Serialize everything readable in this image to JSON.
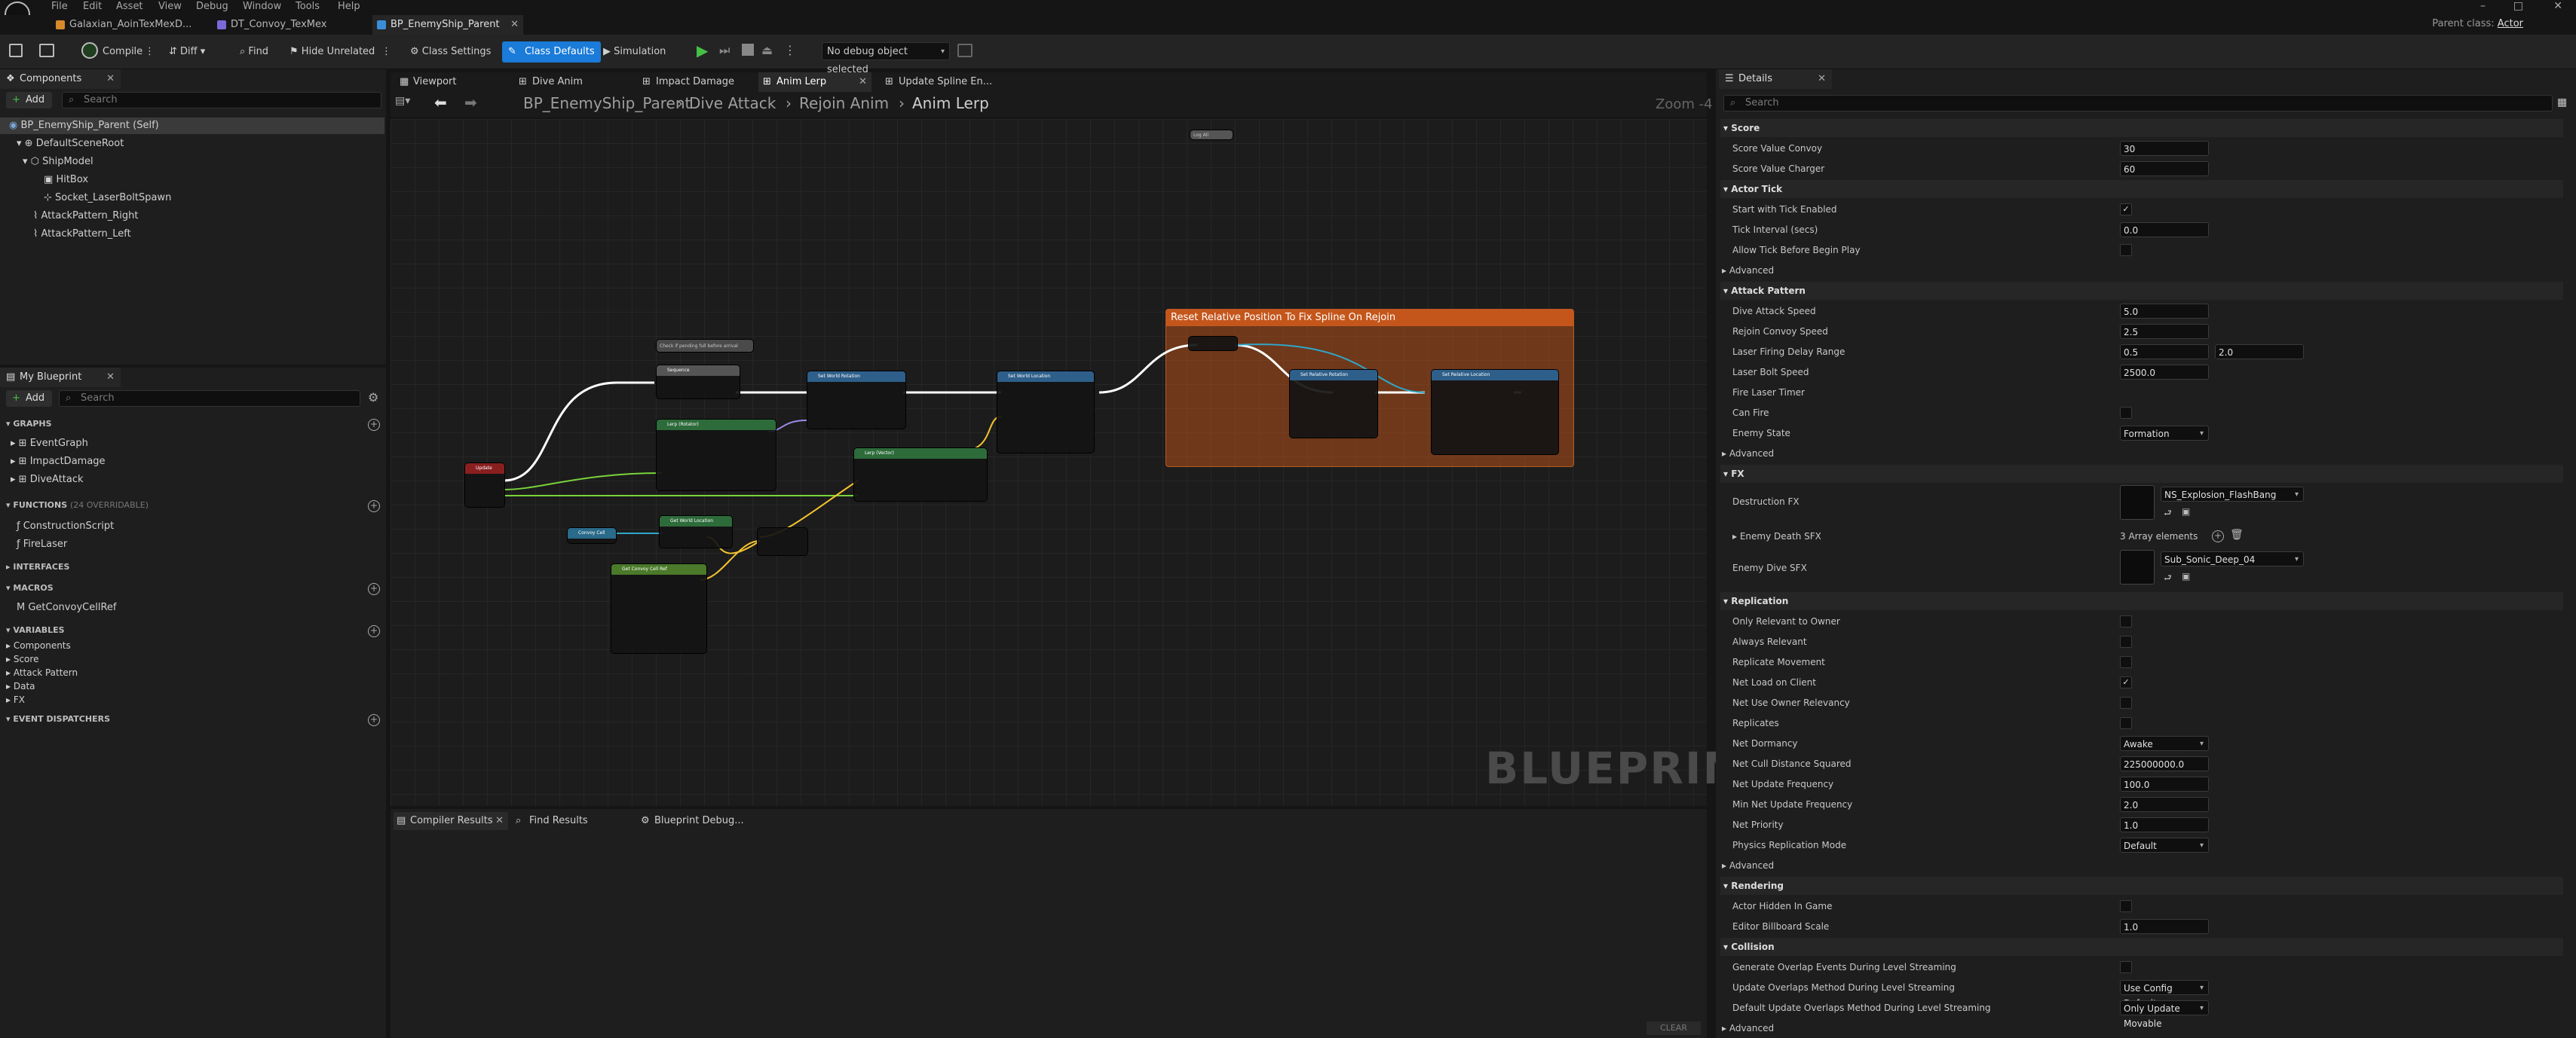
{
  "menu": [
    "File",
    "Edit",
    "Asset",
    "View",
    "Debug",
    "Window",
    "Tools",
    "Help"
  ],
  "right_label": "Parent class:",
  "right_value": "Actor",
  "tabs": [
    {
      "label": "Galaxian_AoinTexMexD..."
    },
    {
      "label": "DT_Convoy_TexMex"
    },
    {
      "label": "BP_EnemyShip_Parent"
    }
  ],
  "toolbar": {
    "compile": "Compile",
    "diff": "Diff",
    "find": "Find",
    "hide_unrelated": "Hide Unrelated",
    "class_settings": "Class Settings",
    "class_defaults": "Class Defaults",
    "simulation": "Simulation",
    "debug_object": "No debug object selected"
  },
  "components": {
    "title": "Components",
    "add": "Add",
    "search_placeholder": "Search",
    "items": [
      "BP_EnemyShip_Parent (Self)",
      "DefaultSceneRoot",
      "ShipModel",
      "HitBox",
      "Socket_LaserBoltSpawn",
      "AttackPattern_Right",
      "AttackPattern_Left"
    ]
  },
  "my_blueprint": {
    "title": "My Blueprint",
    "add": "Add",
    "search_placeholder": "Search",
    "graphs_header": "GRAPHS",
    "graphs": [
      "EventGraph",
      "ImpactDamage",
      "DiveAttack"
    ],
    "functions_header": "FUNCTIONS",
    "functions_count": "(24 OVERRIDABLE)",
    "functions": [
      "ConstructionScript",
      "FireLaser"
    ],
    "interfaces_header": "INTERFACES",
    "macros_header": "MACROS",
    "macros": [
      "GetConvoyCellRef"
    ],
    "variables_header": "VARIABLES",
    "variables": [
      "Components",
      "Score",
      "Attack Pattern",
      "Data",
      "FX"
    ],
    "dispatchers_header": "EVENT DISPATCHERS"
  },
  "graph_tabs": [
    "Viewport",
    "Dive Anim",
    "Impact Damage",
    "Anim Lerp",
    "Update Spline En..."
  ],
  "breadcrumb": [
    "BP_EnemyShip_Parent",
    "Dive Attack",
    "Rejoin Anim",
    "Anim Lerp"
  ],
  "zoom": "Zoom -4",
  "watermark": "BLUEPRINT",
  "comment_box": "Reset Relative Position To Fix Spline On Rejoin",
  "nodes": {
    "update": "Update",
    "lerp_vector": "Lerp (Vector)",
    "lerp_rotator": "Lerp (Rotator)",
    "set_world_rotation": "Set World Rotation",
    "set_world_location": "Set World Location",
    "set_rel_rotation": "Set Relative Rotation",
    "set_rel_location": "Set Relative Location",
    "get_world_location": "Get World Location",
    "get_convoy": "Get Convoy Cell Ref",
    "convoy_cell": "Convoy Cell",
    "comment_small": "Check if pending full before arrival",
    "seq_then": "Sequence",
    "log": "Log All"
  },
  "bottom_tabs": [
    "Compiler Results",
    "Find Results",
    "Blueprint Debug..."
  ],
  "clear": "CLEAR",
  "details": {
    "title": "Details",
    "search_placeholder": "Search",
    "sections": [
      {
        "name": "Score",
        "rows": [
          {
            "label": "Score Value Convoy",
            "value": "30"
          },
          {
            "label": "Score Value Charger",
            "value": "60"
          }
        ]
      },
      {
        "name": "Actor Tick",
        "rows": [
          {
            "label": "Start with Tick Enabled",
            "check": "✓"
          },
          {
            "label": "Tick Interval (secs)",
            "value": "0.0"
          },
          {
            "label": "Allow Tick Before Begin Play",
            "check": ""
          },
          {
            "label": "Advanced",
            "adv": true
          }
        ]
      },
      {
        "name": "Attack Pattern",
        "rows": [
          {
            "label": "Dive Attack Speed",
            "value": "5.0"
          },
          {
            "label": "Rejoin Convoy Speed",
            "value": "2.5"
          },
          {
            "label": "Laser Firing Delay Range",
            "value": "0.5",
            "value2": "2.0"
          },
          {
            "label": "Laser Bolt Speed",
            "value": "2500.0"
          },
          {
            "label": "Fire Laser Timer"
          },
          {
            "label": "Can Fire",
            "check": ""
          },
          {
            "label": "Enemy State",
            "drop": "Formation"
          },
          {
            "label": "Advanced",
            "adv": true
          }
        ]
      }
    ],
    "fx_header": "FX",
    "destruction_fx_label": "Destruction FX",
    "destruction_fx_value": "NS_Explosion_FlashBang",
    "enemy_death_sfx_label": "Enemy Death SFX",
    "enemy_death_sfx_value": "3 Array elements",
    "enemy_dive_sfx_label": "Enemy Dive SFX",
    "enemy_dive_sfx_value": "Sub_Sonic_Deep_04",
    "replication_header": "Replication",
    "replication": [
      {
        "label": "Only Relevant to Owner",
        "check": ""
      },
      {
        "label": "Always Relevant",
        "check": ""
      },
      {
        "label": "Replicate Movement",
        "check": ""
      },
      {
        "label": "Net Load on Client",
        "check": "✓"
      },
      {
        "label": "Net Use Owner Relevancy",
        "check": ""
      },
      {
        "label": "Replicates",
        "check": ""
      },
      {
        "label": "Net Dormancy",
        "drop": "Awake"
      },
      {
        "label": "Net Cull Distance Squared",
        "value": "225000000.0"
      },
      {
        "label": "Net Update Frequency",
        "value": "100.0"
      },
      {
        "label": "Min Net Update Frequency",
        "value": "2.0"
      },
      {
        "label": "Net Priority",
        "value": "1.0"
      },
      {
        "label": "Physics Replication Mode",
        "drop": "Default"
      },
      {
        "label": "Advanced",
        "adv": true
      }
    ],
    "rendering_header": "Rendering",
    "rendering": [
      {
        "label": "Actor Hidden In Game",
        "check": ""
      },
      {
        "label": "Editor Billboard Scale",
        "value": "1.0"
      }
    ],
    "collision_header": "Collision",
    "collision": [
      {
        "label": "Generate Overlap Events During Level Streaming",
        "check": ""
      },
      {
        "label": "Update Overlaps Method During Level Streaming",
        "drop": "Use Config Default"
      },
      {
        "label": "Default Update Overlaps Method During Level Streaming",
        "drop": "Only Update Movable"
      },
      {
        "label": "Advanced",
        "adv": true
      }
    ]
  },
  "colors": {
    "accent": "#1a7bd8",
    "comment": "#d4631e",
    "exec": "#ffffff",
    "vector": "#f5c430",
    "green": "#7ad43a"
  }
}
